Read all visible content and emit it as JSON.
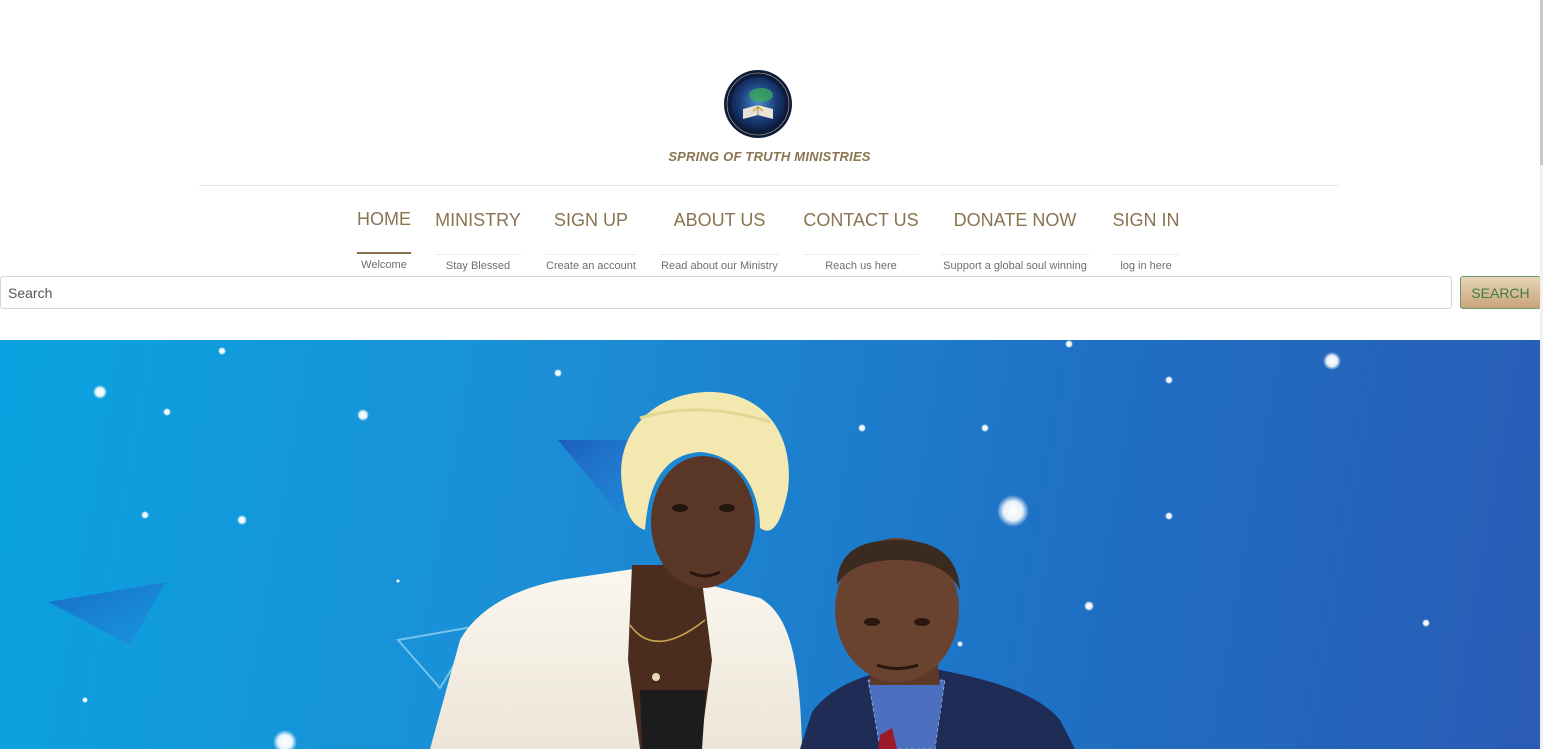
{
  "brand": {
    "name": "SPRING OF TRUTH MINISTRIES",
    "logo_text": "SPRING OF TRUTH MINISTRIES"
  },
  "nav": {
    "items": [
      {
        "label": "HOME",
        "sub": "Welcome",
        "active": true
      },
      {
        "label": "MINISTRY",
        "sub": "Stay Blessed",
        "active": false
      },
      {
        "label": "SIGN UP",
        "sub": "Create an account",
        "active": false
      },
      {
        "label": "ABOUT US",
        "sub": "Read about our Ministry",
        "active": false
      },
      {
        "label": "CONTACT US",
        "sub": "Reach us here",
        "active": false
      },
      {
        "label": "DONATE NOW",
        "sub": "Support a global soul winning",
        "active": false
      },
      {
        "label": "SIGN IN",
        "sub": "log in here",
        "active": false
      }
    ]
  },
  "search": {
    "placeholder": "Search",
    "button_label": "SEARCH"
  },
  "colors": {
    "nav_text": "#8a7450",
    "hero_start": "#0aa3e0",
    "hero_end": "#2a5bb5",
    "search_button_text": "#3f7d3f"
  }
}
